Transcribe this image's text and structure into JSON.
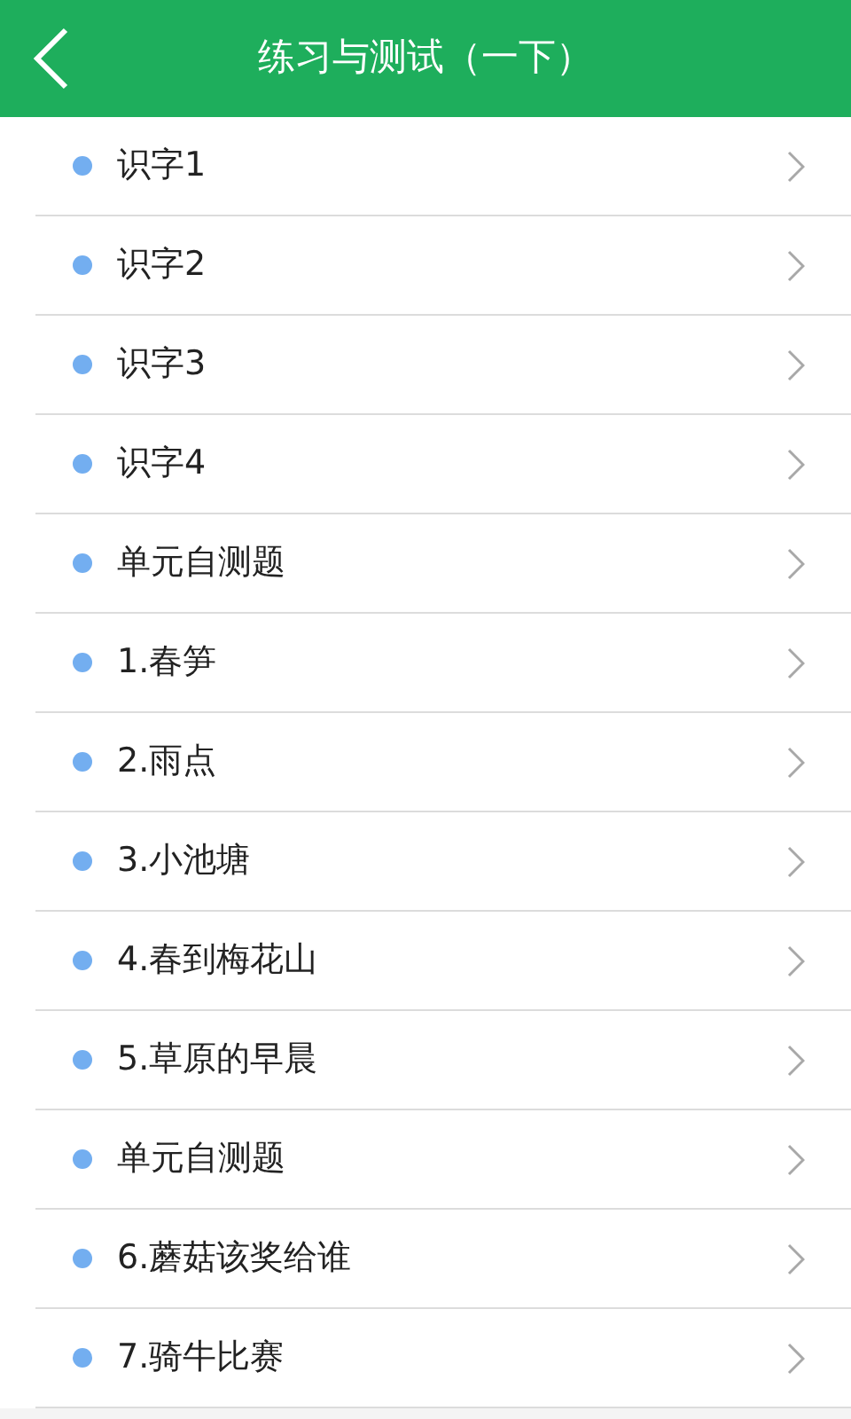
{
  "header": {
    "title": "练习与测试（一下）"
  },
  "items": [
    {
      "label": "识字1"
    },
    {
      "label": "识字2"
    },
    {
      "label": "识字3"
    },
    {
      "label": "识字4"
    },
    {
      "label": "单元自测题"
    },
    {
      "label": "1.春笋"
    },
    {
      "label": "2.雨点"
    },
    {
      "label": "3.小池塘"
    },
    {
      "label": "4.春到梅花山"
    },
    {
      "label": "5.草原的早晨"
    },
    {
      "label": "单元自测题"
    },
    {
      "label": "6.蘑菇该奖给谁"
    },
    {
      "label": "7.骑牛比赛"
    }
  ]
}
